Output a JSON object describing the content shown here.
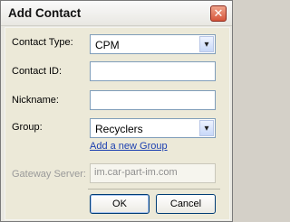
{
  "window": {
    "title": "Add Contact",
    "close_icon": "✕"
  },
  "form": {
    "contact_type": {
      "label": "Contact Type:",
      "value": "CPM",
      "arrow": "▾"
    },
    "contact_id": {
      "label": "Contact ID:",
      "value": ""
    },
    "nickname": {
      "label": "Nickname:",
      "value": ""
    },
    "group": {
      "label": "Group:",
      "value": "Recyclers",
      "arrow": "▾"
    },
    "add_group_link": "Add a new Group",
    "gateway_server": {
      "label": "Gateway Server:",
      "value": "im.car-part-im.com"
    }
  },
  "buttons": {
    "ok": "OK",
    "cancel": "Cancel"
  },
  "colors": {
    "link": "#1b3fb0",
    "close": "#d6553a"
  }
}
